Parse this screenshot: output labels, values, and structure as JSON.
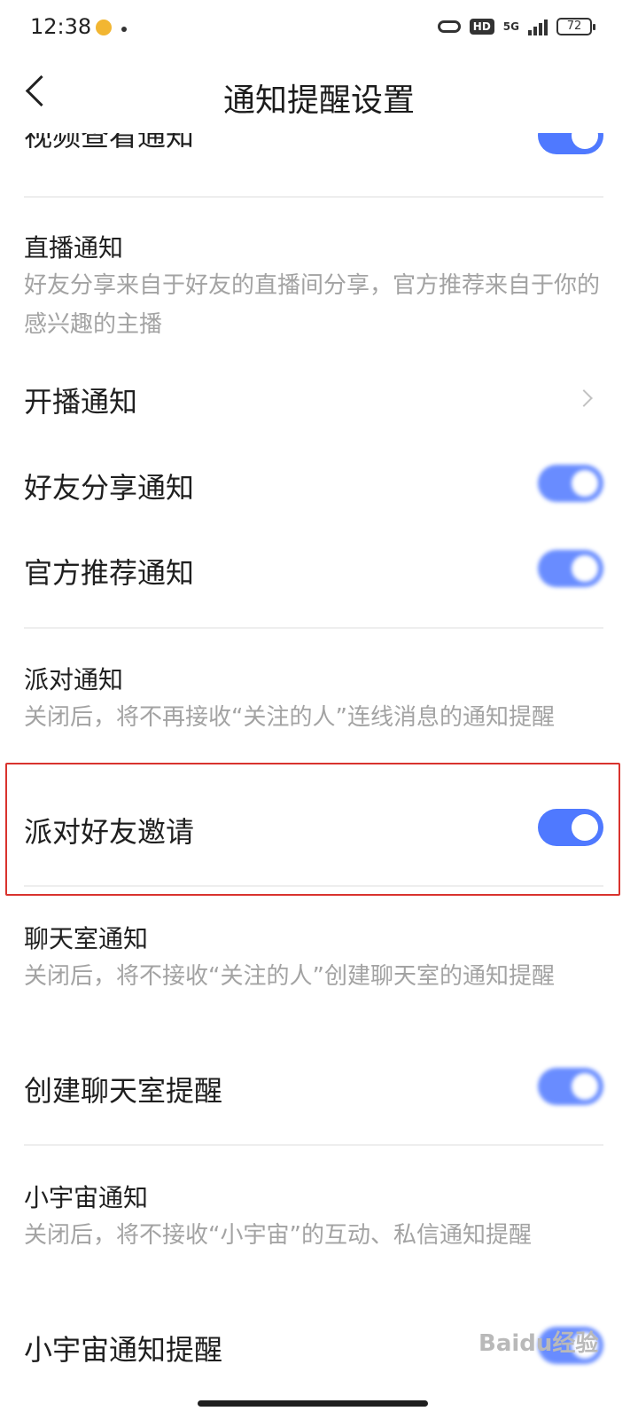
{
  "status_bar": {
    "time": "12:38",
    "network": "5G",
    "hd": "HD",
    "battery": "72"
  },
  "header": {
    "title": "通知提醒设置"
  },
  "partial_item": {
    "label": "视频查看通知"
  },
  "sections": {
    "live": {
      "title": "直播通知",
      "desc": "好友分享来自于好友的直播间分享，官方推荐来自于你的感兴趣的主播",
      "items": {
        "start": {
          "label": "开播通知"
        },
        "friend_share": {
          "label": "好友分享通知"
        },
        "official": {
          "label": "官方推荐通知"
        }
      }
    },
    "party": {
      "title": "派对通知",
      "desc": "关闭后，将不再接收“关注的人”连线消息的通知提醒",
      "items": {
        "invite": {
          "label": "派对好友邀请"
        }
      }
    },
    "chatroom": {
      "title": "聊天室通知",
      "desc": "关闭后，将不接收“关注的人”创建聊天室的通知提醒",
      "items": {
        "create": {
          "label": "创建聊天室提醒"
        }
      }
    },
    "universe": {
      "title": "小宇宙通知",
      "desc": "关闭后，将不接收“小宇宙”的互动、私信通知提醒",
      "items": {
        "notify": {
          "label": "小宇宙通知提醒"
        }
      }
    }
  },
  "toggles": {
    "video_view": true,
    "friend_share": true,
    "official": true,
    "party_invite": true,
    "chatroom_create": true,
    "universe_notify": true
  },
  "colors": {
    "accent": "#4f79ff",
    "highlight": "#d9332e"
  },
  "watermark": "Baidu经验"
}
